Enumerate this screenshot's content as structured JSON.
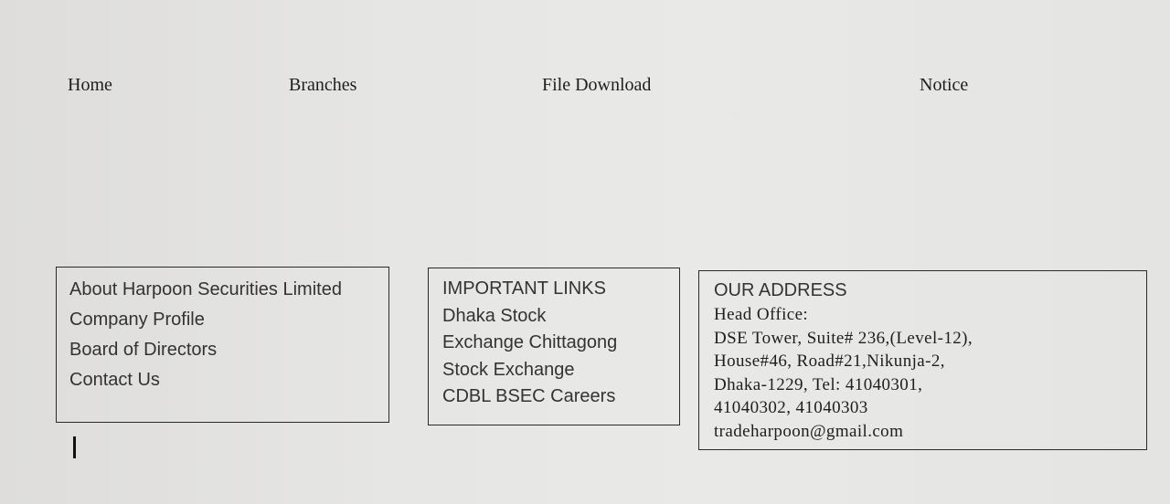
{
  "nav": {
    "home": "Home",
    "branches": "Branches",
    "file_download": "File Download",
    "notice": "Notice"
  },
  "about": {
    "items": [
      "About Harpoon Securities Limited",
      "Company Profile",
      "Board of Directors",
      "Contact Us"
    ]
  },
  "important_links": {
    "heading": "IMPORTANT LINKS",
    "lines": [
      "Dhaka Stock",
      "Exchange Chittagong",
      "Stock Exchange",
      "CDBL BSEC Careers"
    ]
  },
  "address": {
    "heading": "OUR ADDRESS",
    "lines": [
      "Head Office:",
      "DSE Tower, Suite# 236,(Level-12),",
      "House#46, Road#21,Nikunja-2,",
      "Dhaka-1229, Tel: 41040301,",
      "41040302, 41040303",
      "tradeharpoon@gmail.com"
    ]
  },
  "colors": {
    "background": "#e3e3e1",
    "text": "#1e1e1e",
    "border": "#2a2a2a"
  }
}
